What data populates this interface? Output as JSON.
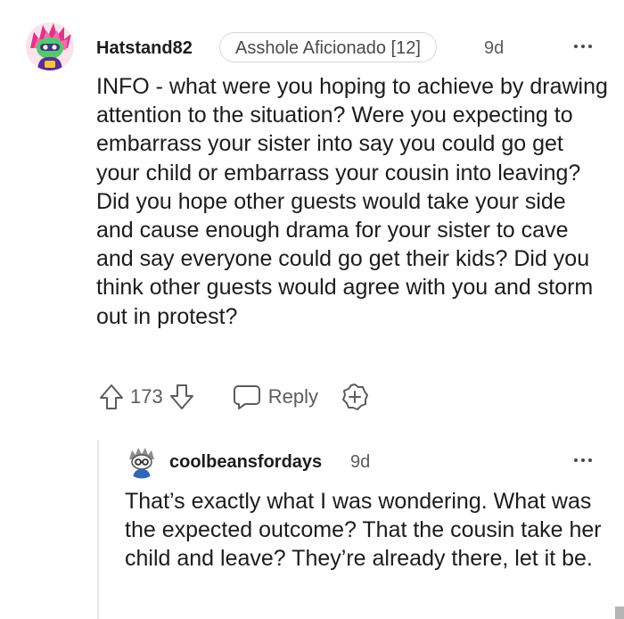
{
  "comment": {
    "username": "Hatstand82",
    "flair": "Asshole Aficionado [12]",
    "time": "9d",
    "body": "INFO - what were you hoping to achieve by drawing attention to the situation? Were you expecting to embarrass your sister into say you could go get your child or embarrass your cousin into leaving? Did you hope other guests would take your side and cause enough drama for your sister to cave and say everyone could go get their kids? Did you think other guests would agree with you and storm out in protest?",
    "votes": "173",
    "reply_label": "Reply",
    "icons": {
      "avatar": "snoo-avatar-icon",
      "more": "more-options-icon",
      "upvote": "upvote-arrow-icon",
      "downvote": "downvote-arrow-icon",
      "reply": "speech-bubble-icon",
      "award": "award-plus-icon"
    }
  },
  "reply": {
    "username": "coolbeansfordays",
    "time": "9d",
    "body": "That’s exactly what I was wondering. What was the expected outcome? That the cousin take her child and leave? They’re already there, let it be.",
    "icons": {
      "avatar": "snoo-avatar-icon",
      "more": "more-options-icon"
    }
  },
  "colors": {
    "text_primary": "#1c1c1c",
    "text_secondary": "#5c5c5c",
    "flair_border": "#d6d6d6",
    "thread_line": "#e6e6e6"
  }
}
